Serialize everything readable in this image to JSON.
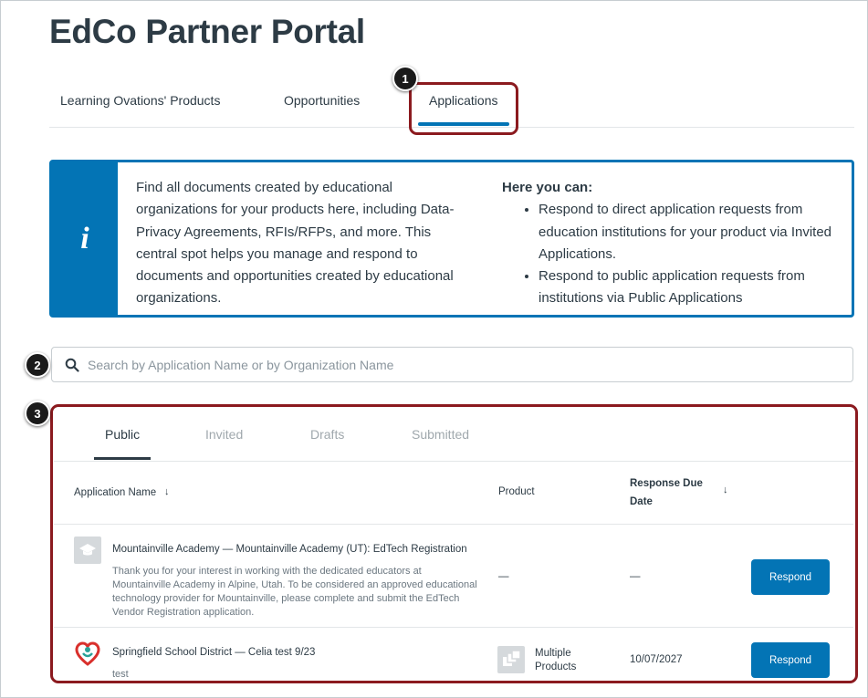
{
  "portal": {
    "title": "EdCo Partner Portal"
  },
  "nav": {
    "tabs": [
      {
        "label": "Learning Ovations' Products"
      },
      {
        "label": "Opportunities"
      },
      {
        "label": "Applications"
      }
    ],
    "active": "Applications"
  },
  "callouts": [
    "1",
    "2",
    "3"
  ],
  "info": {
    "icon": "info-icon",
    "left_text": "Find all documents created by educational organizations for your products here, including Data-Privacy Agreements, RFIs/RFPs, and more. This central spot helps you manage and respond to documents and opportunities created by educational organizations.",
    "right_heading": "Here you can:",
    "bullets": [
      "Respond to direct application requests from education institutions for your product via Invited Applications.",
      "Respond to public application requests from institutions via Public Applications"
    ]
  },
  "search": {
    "placeholder": "Search by Application Name or by Organization Name",
    "value": ""
  },
  "subtabs": [
    {
      "label": "Public"
    },
    {
      "label": "Invited"
    },
    {
      "label": "Drafts"
    },
    {
      "label": "Submitted"
    }
  ],
  "table": {
    "headers": {
      "name": "Application Name",
      "product": "Product",
      "due": "Response Due Date"
    },
    "rows": [
      {
        "title": "Mountainville Academy — Mountainville Academy (UT): EdTech Registration",
        "description": "Thank you for your interest in working with the dedicated educators at Mountainville Academy in Alpine, Utah. To be considered an approved educational technology provider for Mountainville, please complete and submit the EdTech Vendor Registration application.",
        "product": "—",
        "due": "—",
        "action": "Respond"
      },
      {
        "title": "Springfield School District — Celia test 9/23",
        "description": "test",
        "product": "Multiple Products",
        "due": "10/07/2027",
        "action": "Respond"
      }
    ]
  },
  "colors": {
    "accent": "#0374b5",
    "highlight": "#8b1a1f",
    "text": "#2d3b45"
  }
}
